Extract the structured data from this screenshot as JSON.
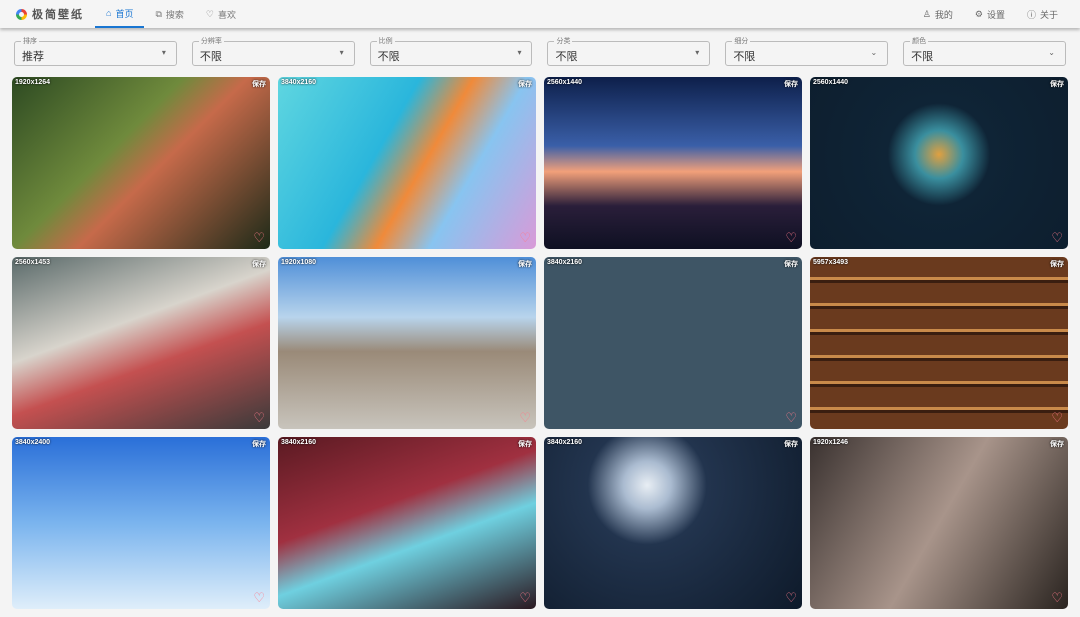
{
  "app": {
    "title": "极简壁纸"
  },
  "nav": {
    "tabs": [
      {
        "label": "首页",
        "icon": "home-icon"
      },
      {
        "label": "搜索",
        "icon": "search-icon"
      },
      {
        "label": "喜欢",
        "icon": "heart-icon"
      }
    ],
    "right": [
      {
        "label": "我的",
        "icon": "user-icon"
      },
      {
        "label": "设置",
        "icon": "gear-icon"
      },
      {
        "label": "关于",
        "icon": "info-icon"
      }
    ]
  },
  "filters": [
    {
      "label": "排序",
      "value": "推荐"
    },
    {
      "label": "分辨率",
      "value": "不限"
    },
    {
      "label": "比例",
      "value": "不限"
    },
    {
      "label": "分类",
      "value": "不限"
    },
    {
      "label": "细分",
      "value": "不限"
    },
    {
      "label": "颜色",
      "value": "不限"
    }
  ],
  "save_label": "保存",
  "wallpapers": [
    {
      "res": "1920x1264",
      "bg": "linear-gradient(135deg,#2d4a22,#6f8a3c 40%,#c66a4a 55%,#1d2a18)"
    },
    {
      "res": "3840x2160",
      "bg": "linear-gradient(120deg,#5fd6e0,#2ab6dc 40%,#f08a3a 55%,#88c4f0 70%,#d99ad8)"
    },
    {
      "res": "2560x1440",
      "bg": "linear-gradient(180deg,#0d1f4a,#3a5fa8 40%,#f2a07a 55%,#2a1e3a 75%,#0e1022)"
    },
    {
      "res": "2560x1440",
      "bg": "radial-gradient(circle at 50% 45%,#e0a040 0,#3a8f9f 15%,#0f2436 32%,#0d1e2e)"
    },
    {
      "res": "2560x1453",
      "bg": "linear-gradient(160deg,#5a6a6a,#d8d4cc 40%,#c45050 60%,#3a3a3a)"
    },
    {
      "res": "1920x1080",
      "bg": "linear-gradient(180deg,#4f8fd8,#b8d4ec 35%,#9a8a78 55%,#c8c4bc)"
    },
    {
      "res": "3840x2160",
      "bg": "#3e5565"
    },
    {
      "res": "5957x3493",
      "bg": "repeating-linear-gradient(180deg,#6a3a1e 0 20px,#c98a4a 20px 23px,#3a1e10 23px 26px)"
    },
    {
      "res": "3840x2400",
      "bg": "linear-gradient(180deg,#2a6fd8,#7ab4ee 50%,#dfeefa)"
    },
    {
      "res": "3840x2160",
      "bg": "linear-gradient(160deg,#5a1a22,#a03040 40%,#6fd0e0 60%,#2a1820)"
    },
    {
      "res": "3840x2160",
      "bg": "radial-gradient(circle at 40% 28%,#e8eef4 0,#aabbd0 12%,#22344e 30%,#0e1a2a)"
    },
    {
      "res": "1920x1246",
      "bg": "linear-gradient(120deg,#3a3230,#a8948a 50%,#2a2420)"
    }
  ]
}
